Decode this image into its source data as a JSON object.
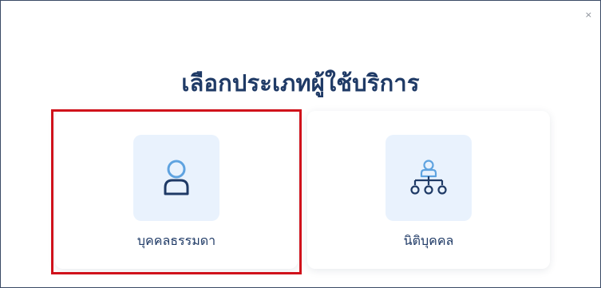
{
  "dialog": {
    "close_label": "×",
    "title": "เลือกประเภทผู้ใช้บริการ"
  },
  "options": [
    {
      "label": "บุคคลธรรมดา",
      "icon": "person-icon"
    },
    {
      "label": "นิติบุคคล",
      "icon": "organization-icon"
    }
  ],
  "colors": {
    "title": "#1f3a66",
    "icon_dark": "#1f3a66",
    "icon_light": "#5fa3e0",
    "icon_bg": "#e9f2fd",
    "highlight": "#d0121b",
    "border": "#3a4a66"
  }
}
